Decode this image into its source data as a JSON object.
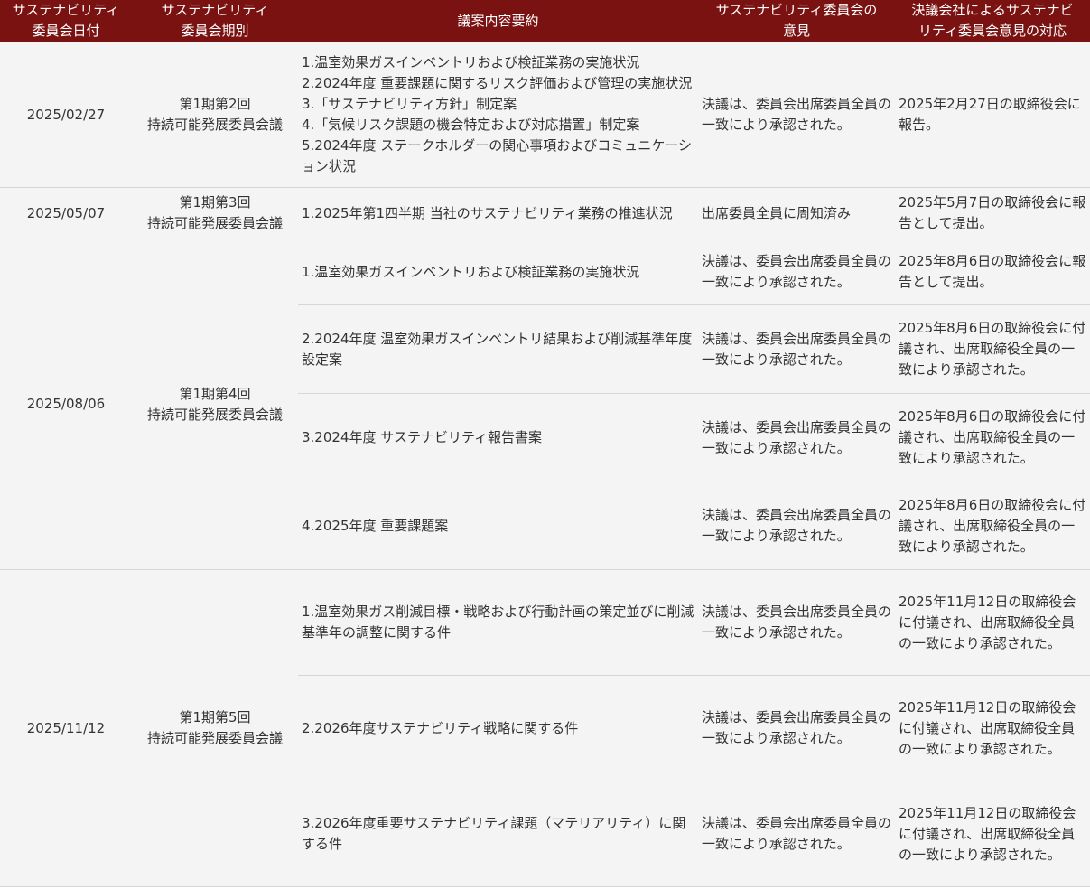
{
  "headers": {
    "date": [
      "サステナビリティ",
      "委員会日付"
    ],
    "period": [
      "サステナビリティ",
      "委員会期別"
    ],
    "content": [
      "議案内容要約"
    ],
    "opinion": [
      "サステナビリティ委員会の",
      "意見"
    ],
    "response": [
      "決議会社によるサステナビ",
      "リティ委員会意見の対応"
    ]
  },
  "meetings": [
    {
      "date": "2025/02/27",
      "period": [
        "第1期第2回",
        "持続可能発展委員会議"
      ],
      "content": [
        "1.温室効果ガスインベントリおよび検証業務の実施状況",
        "2.2024年度 重要課題に関するリスク評価および管理の実施状況",
        "3.「サステナビリティ方針」制定案",
        "4.「気候リスク課題の機会特定および対応措置」制定案",
        "5.2024年度 ステークホルダーの関心事項およびコミュニケーション状況"
      ],
      "opinion": "決議は、委員会出席委員全員の一致により承認された。",
      "response": "2025年2月27日の取締役会に報告。"
    },
    {
      "date": "2025/05/07",
      "period": [
        "第1期第3回",
        "持続可能発展委員会議"
      ],
      "content": [
        "1.2025年第1四半期 当社のサステナビリティ業務の推進状況"
      ],
      "opinion": "出席委員全員に周知済み",
      "response": "2025年5月7日の取締役会に報告として提出。"
    },
    {
      "date": "2025/08/06",
      "period": [
        "第1期第4回",
        "持続可能発展委員会議"
      ],
      "items": [
        {
          "content": "1.温室効果ガスインベントリおよび検証業務の実施状況",
          "opinion": "決議は、委員会出席委員全員の一致により承認された。",
          "response": "2025年8月6日の取締役会に報告として提出。"
        },
        {
          "content": "2.2024年度 温室効果ガスインベントリ結果および削減基準年度設定案",
          "opinion": "決議は、委員会出席委員全員の一致により承認された。",
          "response": "2025年8月6日の取締役会に付議され、出席取締役全員の一致により承認された。"
        },
        {
          "content": "3.2024年度 サステナビリティ報告書案",
          "opinion": "決議は、委員会出席委員全員の一致により承認された。",
          "response": "2025年8月6日の取締役会に付議され、出席取締役全員の一致により承認された。"
        },
        {
          "content": "4.2025年度 重要課題案",
          "opinion": "決議は、委員会出席委員全員の一致により承認された。",
          "response": "2025年8月6日の取締役会に付議され、出席取締役全員の一致により承認された。"
        }
      ]
    },
    {
      "date": "2025/11/12",
      "period": [
        "第1期第5回",
        "持続可能発展委員会議"
      ],
      "items": [
        {
          "content": "1.温室効果ガス削減目標・戦略および行動計画の策定並びに削減基準年の調整に関する件",
          "opinion": "決議は、委員会出席委員全員の一致により承認された。",
          "response": "2025年11月12日の取締役会に付議され、出席取締役全員の一致により承認された。"
        },
        {
          "content": "2.2026年度サステナビリティ戦略に関する件",
          "opinion": "決議は、委員会出席委員全員の一致により承認された。",
          "response": "2025年11月12日の取締役会に付議され、出席取締役全員の一致により承認された。"
        },
        {
          "content": "3.2026年度重要サステナビリティ課題（マテリアリティ）に関する件",
          "opinion": "決議は、委員会出席委員全員の一致により承認された。",
          "response": "2025年11月12日の取締役会に付議され、出席取締役全員の一致により承認された。"
        }
      ]
    }
  ]
}
